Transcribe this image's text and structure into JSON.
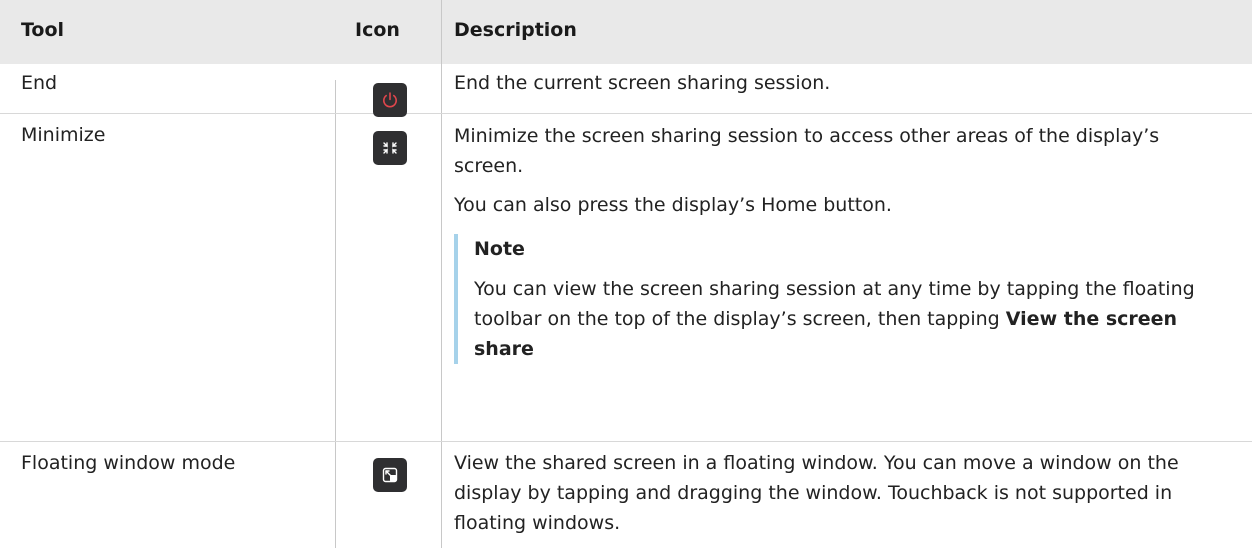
{
  "table": {
    "headers": {
      "tool": "Tool",
      "icon": "Icon",
      "description": "Description"
    },
    "rows": [
      {
        "tool": "End",
        "icon": "power-icon",
        "description": "End the current screen sharing session."
      },
      {
        "tool": "Minimize",
        "icon": "minimize-icon",
        "description": "Minimize the screen sharing session to access other areas of the display’s screen.",
        "description_extra": "You can also press the display’s Home button.",
        "note": {
          "title": "Note",
          "body": "You can view the screen sharing session at any time by tapping the floating toolbar on the top of the display’s screen, then tapping",
          "body_bold": "View the screen share"
        }
      },
      {
        "tool": "Floating window mode",
        "icon": "floating-window-icon",
        "description": "View the shared screen in a floating window. You can move a window on the display by tapping and dragging the window. Touchback is not supported in floating windows."
      }
    ]
  },
  "colors": {
    "header_bg": "#e9e9e9",
    "icon_bg": "#2f2f31",
    "power_red": "#e0464c",
    "note_bar": "#a6d2ea"
  }
}
